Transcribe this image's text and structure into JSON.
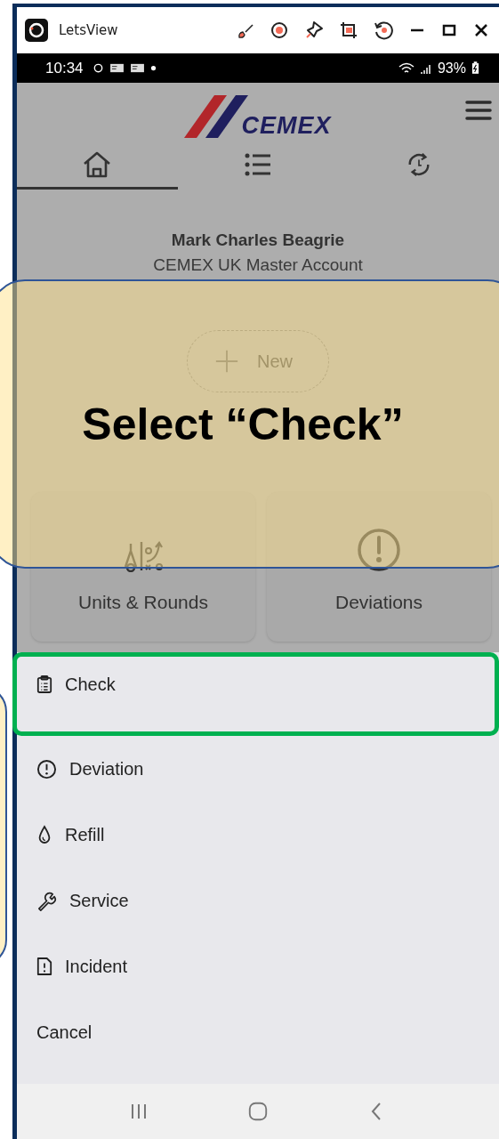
{
  "window": {
    "title": "LetsView"
  },
  "status_bar": {
    "time": "10:34",
    "battery": "93%"
  },
  "app": {
    "logo": "CEMEX"
  },
  "tabs": [
    {
      "kind": "home",
      "selected": true
    },
    {
      "kind": "list",
      "selected": false
    },
    {
      "kind": "history",
      "selected": false
    }
  ],
  "profile": {
    "name": "Mark Charles Beagrie",
    "account": "CEMEX UK Master Account"
  },
  "new_button": {
    "label": "New"
  },
  "cards": [
    {
      "kind": "units",
      "label": "Units & Rounds"
    },
    {
      "kind": "deviations",
      "label": "Deviations"
    }
  ],
  "action_sheet": {
    "items": [
      {
        "kind": "check",
        "label": "Check",
        "highlighted": true
      },
      {
        "kind": "deviation",
        "label": "Deviation",
        "highlighted": false
      },
      {
        "kind": "refill",
        "label": "Refill",
        "highlighted": false
      },
      {
        "kind": "service",
        "label": "Service",
        "highlighted": false
      },
      {
        "kind": "incident",
        "label": "Incident",
        "highlighted": false
      },
      {
        "kind": "cancel",
        "label": "Cancel",
        "highlighted": false
      }
    ]
  },
  "callout": {
    "text": "Select “Check”"
  }
}
